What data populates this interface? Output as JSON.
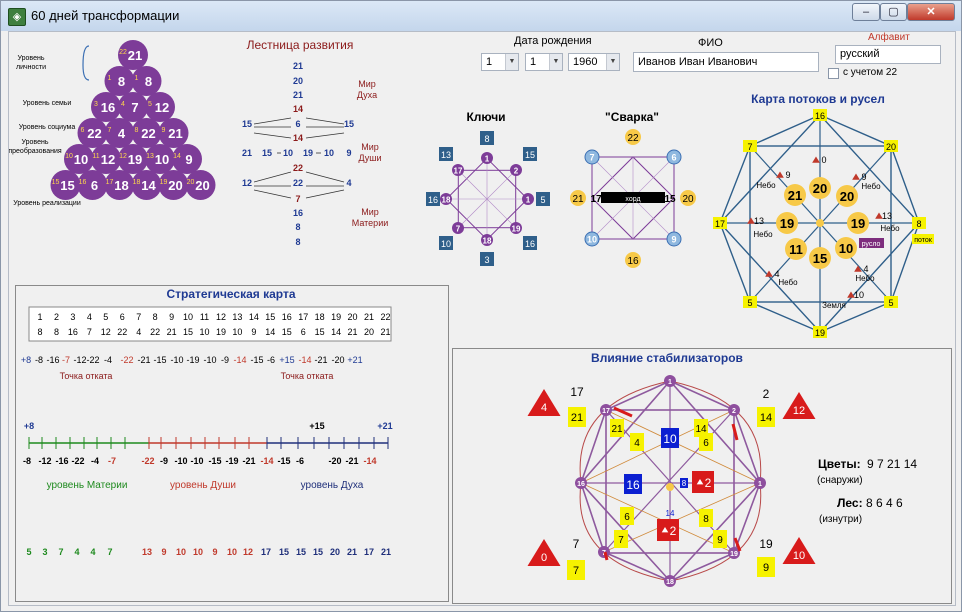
{
  "window": {
    "title": "60 дней трансформации",
    "min": "–",
    "max": "▢",
    "close": "✕"
  },
  "colors": {
    "purple": "#7d3c98",
    "blue": "#1f3a93",
    "red": "#c0392b",
    "green": "#1e8a1e",
    "yellow": "#f6f200",
    "orange": "#f7c948",
    "steel": "#2f5f8a"
  },
  "birth": {
    "label": "Дата рождения",
    "day": "1",
    "month": "1",
    "year": "1960"
  },
  "fio": {
    "label": "ФИО",
    "value": "Иванов Иван Иванович"
  },
  "alphabet": {
    "label": "Алфавит",
    "value": "русский",
    "check_label": "с учетом 22"
  },
  "pyramid": {
    "levels": [
      "Уровень личности",
      "Уровень семьи",
      "Уровень социума",
      "Уровень преобразования",
      "Уровень реализации"
    ],
    "rows": [
      [
        "21"
      ],
      [
        "8",
        "8"
      ],
      [
        "16",
        "7",
        "12"
      ],
      [
        "22",
        "4",
        "22",
        "21"
      ],
      [
        "10",
        "12",
        "19",
        "10",
        "9"
      ],
      [
        "15",
        "6",
        "18",
        "14",
        "20",
        "20"
      ]
    ],
    "small": [
      [
        "22"
      ],
      [
        "1",
        "1"
      ],
      [
        "3",
        "4",
        "5"
      ],
      [
        "6",
        "7",
        "8",
        "9"
      ],
      [
        "10",
        "11",
        "12",
        "13",
        "14"
      ],
      [
        "15",
        "16",
        "17",
        "18",
        "19",
        "20"
      ]
    ]
  },
  "ladder": {
    "title": "Лестница развития",
    "worlds": [
      "Мир Духа",
      "Мир Души",
      "Мир Материи"
    ],
    "nums": [
      "21",
      "20",
      "21",
      "14",
      "15",
      "6",
      "15",
      "14",
      "21",
      "15",
      "10",
      "19",
      "10",
      "9",
      "22",
      "12",
      "22",
      "4",
      "7",
      "16",
      "8",
      "8"
    ]
  },
  "keys": {
    "title": "Ключи",
    "inner": [
      "1",
      "2",
      "1",
      "19",
      "18",
      "7",
      "18",
      "17"
    ],
    "outer": [
      "8",
      "15",
      "5",
      "16",
      "3",
      "10",
      "16",
      "13"
    ]
  },
  "svarka": {
    "title": "\"Сварка\"",
    "top": "22",
    "bottom": "16",
    "left": "21",
    "right": "20",
    "mid_l": "17",
    "mid_r": "15",
    "center": "хорд",
    "corners": [
      "7",
      "6",
      "9",
      "10"
    ]
  },
  "flows": {
    "title": "Карта потоков и русел",
    "outer": [
      "16",
      "20",
      "8",
      "5",
      "19",
      "5",
      "17",
      "7"
    ],
    "circles": [
      "21",
      "20",
      "20",
      "19",
      "19",
      "11",
      "15",
      "10"
    ],
    "marks": [
      "0",
      "9",
      "9",
      "13",
      "13",
      "4",
      "4",
      "10"
    ],
    "words": [
      "Небо",
      "Небо",
      "Небо",
      "Небо",
      "Небо",
      "Небо",
      "Земля"
    ],
    "russlo": "русло",
    "potok": "поток"
  },
  "strategic": {
    "title": "Стратегическая карта",
    "row1": [
      "1",
      "2",
      "3",
      "4",
      "5",
      "6",
      "7",
      "8",
      "9",
      "10",
      "11",
      "12",
      "13",
      "14",
      "15",
      "16",
      "17",
      "18",
      "19",
      "20",
      "21",
      "22"
    ],
    "row2": [
      "8",
      "8",
      "16",
      "7",
      "12",
      "22",
      "4",
      "22",
      "21",
      "15",
      "10",
      "19",
      "10",
      "9",
      "14",
      "15",
      "6",
      "15",
      "14",
      "21",
      "20",
      "21"
    ],
    "seq": [
      "+8",
      "-8",
      "-16",
      "-7",
      "-12",
      "-22",
      "-4",
      "-22",
      "-21",
      "-15",
      "-10",
      "-19",
      "-10",
      "-9",
      "-14",
      "-15",
      "-6",
      "+15",
      "-14",
      "-21",
      "-20",
      "+21"
    ],
    "rollback": "Точка отката",
    "scale_marks": [
      "+8",
      "+15",
      "+21"
    ],
    "scale": [
      "-8",
      "-12",
      "-16",
      "-22",
      "-4",
      "-7",
      "-22",
      "-9",
      "-10",
      "-10",
      "-15",
      "-19",
      "-21",
      "-14",
      "-15",
      "-6",
      "-20",
      "-21",
      "-14"
    ],
    "levels": [
      "уровень Материи",
      "уровень Души",
      "уровень  Духа"
    ],
    "bottom": [
      "5",
      "3",
      "7",
      "4",
      "4",
      "7",
      "13",
      "9",
      "10",
      "10",
      "9",
      "10",
      "12",
      "17",
      "15",
      "15",
      "15",
      "20",
      "21",
      "17",
      "21"
    ]
  },
  "stab": {
    "title": "Влияние стабилизаторов",
    "tri": [
      "4",
      "12",
      "0",
      "10"
    ],
    "big": [
      "17",
      "2",
      "7",
      "19"
    ],
    "yellowSq": [
      "21",
      "14",
      "7",
      "9"
    ],
    "rim": [
      "1",
      "2",
      "1",
      "19",
      "18",
      "7",
      "16",
      "17"
    ],
    "yellowInner": [
      "21",
      "4",
      "14",
      "6",
      "6",
      "7",
      "8",
      "9"
    ],
    "blueSq": [
      "10",
      "16"
    ],
    "redSq": [
      "2",
      "2"
    ],
    "smallNums": [
      "8",
      "14"
    ],
    "colors_label": "Цветы:",
    "colors_value": "9 7 21 14",
    "colors_note": "(снаружи)",
    "forest_label": "Лес:",
    "forest_value": "8 6 4 6",
    "forest_note": "(изнутри)"
  }
}
